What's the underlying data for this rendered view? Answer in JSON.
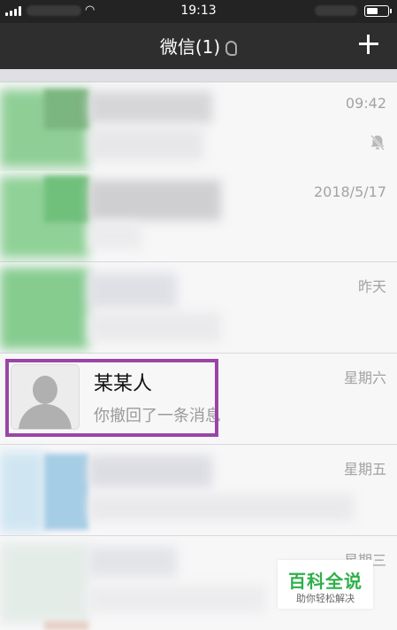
{
  "status_bar": {
    "time": "19:13"
  },
  "nav": {
    "title": "微信(1)"
  },
  "chats": [
    {
      "time": "09:42",
      "muted": true
    },
    {
      "time": "2018/5/17"
    },
    {
      "time": "昨天"
    },
    {
      "time": "星期六",
      "name": "某某人",
      "message": "你撤回了一条消息",
      "highlighted": true
    },
    {
      "time": "星期五"
    },
    {
      "time": "星期三"
    }
  ],
  "watermark": {
    "main": "百科全说",
    "sub": "助你轻松解决"
  },
  "colors": {
    "highlight": "#9a45a6",
    "brand_green": "#2fb04a",
    "navbar": "#2e2e2e"
  }
}
